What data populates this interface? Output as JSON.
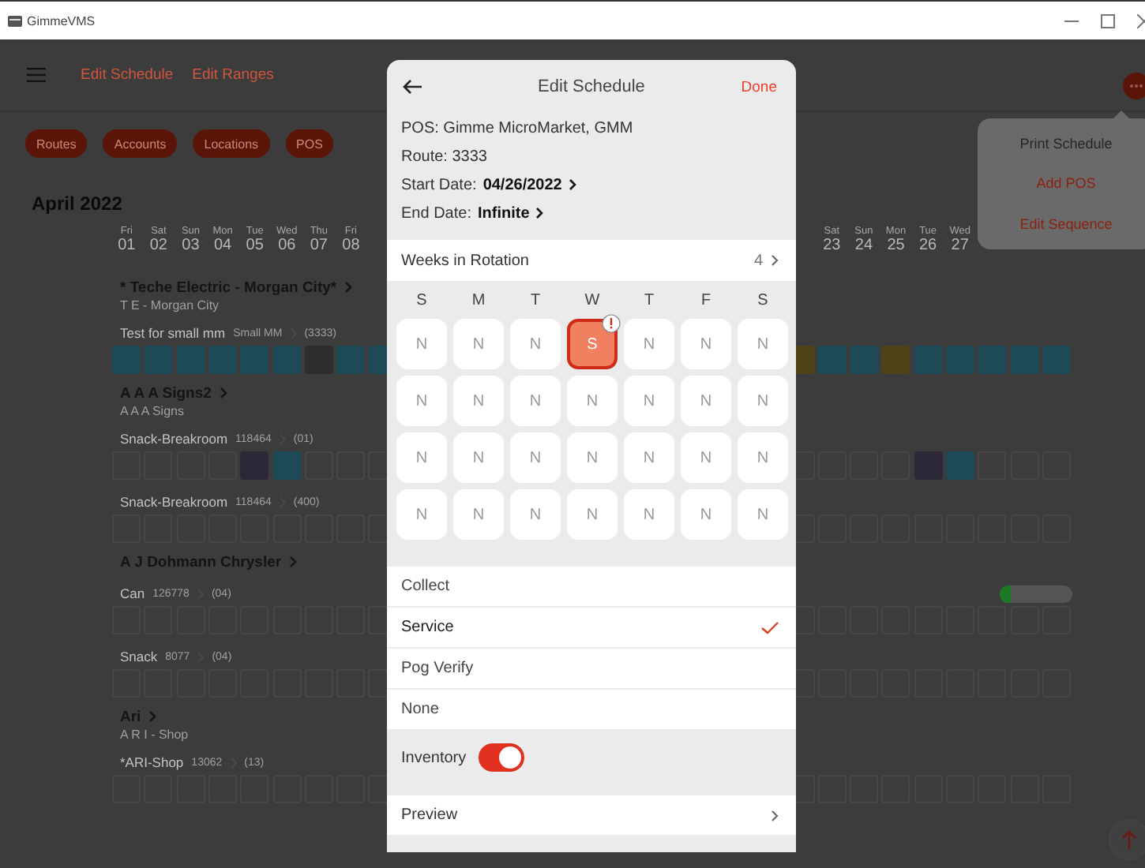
{
  "window": {
    "title": "GimmeVMS"
  },
  "toolbar": {
    "links": [
      "Edit Schedule",
      "Edit Ranges"
    ]
  },
  "filters": [
    "Routes",
    "Accounts",
    "Locations",
    "POS"
  ],
  "month": "April 2022",
  "days": {
    "start": [
      {
        "weekday": "Fri",
        "date": "01"
      },
      {
        "weekday": "Sat",
        "date": "02"
      },
      {
        "weekday": "Sun",
        "date": "03"
      },
      {
        "weekday": "Mon",
        "date": "04"
      },
      {
        "weekday": "Tue",
        "date": "05"
      },
      {
        "weekday": "Wed",
        "date": "06"
      },
      {
        "weekday": "Thu",
        "date": "07"
      },
      {
        "weekday": "Fri",
        "date": "08"
      }
    ],
    "end": [
      {
        "weekday": "Sat",
        "date": "23"
      },
      {
        "weekday": "Sun",
        "date": "24"
      },
      {
        "weekday": "Mon",
        "date": "25"
      },
      {
        "weekday": "Tue",
        "date": "26"
      },
      {
        "weekday": "Wed",
        "date": "27"
      }
    ]
  },
  "locations": [
    {
      "name": "* Teche Electric - Morgan City*",
      "subtitle": "T E - Morgan City",
      "pos": [
        {
          "name": "Test for small mm",
          "code": "Small MM",
          "route": "(3333)",
          "cells_start": [
            {
              "filled": true,
              "color": "#1e4a58"
            },
            {
              "filled": true,
              "color": "#1e4a58"
            },
            {
              "filled": true,
              "color": "#1e4a58"
            },
            {
              "filled": true,
              "color": "#1e4a58"
            },
            {
              "filled": true,
              "color": "#1e4a58"
            },
            {
              "filled": true,
              "color": "#1e4a58"
            },
            {
              "filled": true,
              "color": "#2e2e2e"
            },
            {
              "filled": true,
              "color": "#1e4a58"
            },
            {
              "filled": true,
              "color": "#1e4a58"
            }
          ],
          "cells_end": [
            {
              "filled": true,
              "color": "#4d4218"
            },
            {
              "filled": true,
              "color": "#1e4a58"
            },
            {
              "filled": true,
              "color": "#1e4a58"
            },
            {
              "filled": true,
              "color": "#4d4218"
            },
            {
              "filled": true,
              "color": "#1e4a58"
            },
            {
              "filled": true,
              "color": "#1e4a58"
            },
            {
              "filled": true,
              "color": "#1e4a58"
            },
            {
              "filled": true,
              "color": "#1e4a58"
            },
            {
              "filled": true,
              "color": "#1e4a58"
            }
          ]
        }
      ]
    },
    {
      "name": "A A A Signs2",
      "subtitle": "A A A Signs",
      "pos": [
        {
          "name": "Snack-Breakroom",
          "code": "118464",
          "route": "(01)",
          "cells_start": [
            {
              "filled": false
            },
            {
              "filled": false
            },
            {
              "filled": false
            },
            {
              "filled": false
            },
            {
              "filled": true,
              "color": "#2c2838"
            },
            {
              "filled": true,
              "color": "#1e4a58"
            },
            {
              "filled": false
            },
            {
              "filled": false
            },
            {
              "filled": false
            }
          ],
          "cells_end": [
            {
              "filled": false
            },
            {
              "filled": false
            },
            {
              "filled": false
            },
            {
              "filled": false
            },
            {
              "filled": true,
              "color": "#2c2838"
            },
            {
              "filled": true,
              "color": "#1e4a58"
            },
            {
              "filled": false
            },
            {
              "filled": false
            },
            {
              "filled": false
            }
          ]
        },
        {
          "name": "Snack-Breakroom",
          "code": "118464",
          "route": "(400)",
          "cells_start": [
            {
              "filled": false
            },
            {
              "filled": false
            },
            {
              "filled": false
            },
            {
              "filled": false
            },
            {
              "filled": false
            },
            {
              "filled": false
            },
            {
              "filled": false
            },
            {
              "filled": false
            },
            {
              "filled": false
            }
          ],
          "cells_end": [
            {
              "filled": false
            },
            {
              "filled": false
            },
            {
              "filled": false
            },
            {
              "filled": false
            },
            {
              "filled": false
            },
            {
              "filled": false
            },
            {
              "filled": false
            },
            {
              "filled": false
            },
            {
              "filled": false
            }
          ]
        }
      ]
    },
    {
      "name": "A J Dohmann Chrysler",
      "pos": [
        {
          "name": "Can",
          "code": "126778",
          "route": "(04)",
          "level": 0.15,
          "cells_start": [
            {
              "filled": false
            },
            {
              "filled": false
            },
            {
              "filled": false
            },
            {
              "filled": false
            },
            {
              "filled": false
            },
            {
              "filled": false
            },
            {
              "filled": false
            },
            {
              "filled": false
            },
            {
              "filled": false
            }
          ],
          "cells_end": [
            {
              "filled": false
            },
            {
              "filled": false
            },
            {
              "filled": false
            },
            {
              "filled": false
            },
            {
              "filled": false
            },
            {
              "filled": false
            },
            {
              "filled": false
            },
            {
              "filled": false
            },
            {
              "filled": false
            }
          ]
        },
        {
          "name": "Snack",
          "code": "8077",
          "route": "(04)",
          "cells_start": [
            {
              "filled": false
            },
            {
              "filled": false
            },
            {
              "filled": false
            },
            {
              "filled": false
            },
            {
              "filled": false
            },
            {
              "filled": false
            },
            {
              "filled": false
            },
            {
              "filled": false
            },
            {
              "filled": false
            }
          ],
          "cells_end": [
            {
              "filled": false
            },
            {
              "filled": false
            },
            {
              "filled": false
            },
            {
              "filled": false
            },
            {
              "filled": false
            },
            {
              "filled": false
            },
            {
              "filled": false
            },
            {
              "filled": false
            },
            {
              "filled": false
            }
          ]
        }
      ]
    },
    {
      "name": "Ari",
      "subtitle": "A R I - Shop",
      "pos": [
        {
          "name": "*ARI-Shop",
          "code": "13062",
          "route": "(13)",
          "cells_start": [
            {
              "filled": false
            },
            {
              "filled": false
            },
            {
              "filled": false
            },
            {
              "filled": false
            },
            {
              "filled": false
            },
            {
              "filled": false
            },
            {
              "filled": false
            },
            {
              "filled": false
            },
            {
              "filled": false
            }
          ],
          "cells_end": [
            {
              "filled": false
            },
            {
              "filled": false
            },
            {
              "filled": false
            },
            {
              "filled": false
            },
            {
              "filled": false
            },
            {
              "filled": false
            },
            {
              "filled": false
            },
            {
              "filled": false
            },
            {
              "filled": false
            }
          ]
        }
      ]
    }
  ],
  "menu": [
    {
      "label": "Print Schedule",
      "disabled": true
    },
    {
      "label": "Add POS",
      "disabled": false
    },
    {
      "label": "Edit Sequence",
      "disabled": false
    }
  ],
  "editor": {
    "title": "Edit Schedule",
    "done": "Done",
    "info": [
      {
        "label": "POS: Gimme MicroMarket, GMM"
      },
      {
        "label": "Route: 3333"
      },
      {
        "label": "Start Date:",
        "value": "04/26/2022"
      },
      {
        "label": "End Date:",
        "value": "Infinite"
      }
    ],
    "rotation": {
      "label": "Weeks in Rotation",
      "value": "4"
    },
    "weekdays": [
      "S",
      "M",
      "T",
      "W",
      "T",
      "F",
      "S"
    ],
    "weeks": [
      [
        {
          "letter": "N",
          "selected": false,
          "alert": false
        },
        {
          "letter": "N",
          "selected": false,
          "alert": false
        },
        {
          "letter": "N",
          "selected": false,
          "alert": false
        },
        {
          "letter": "S",
          "selected": true,
          "alert": true
        },
        {
          "letter": "N",
          "selected": false,
          "alert": false
        },
        {
          "letter": "N",
          "selected": false,
          "alert": false
        },
        {
          "letter": "N",
          "selected": false,
          "alert": false
        }
      ],
      [
        {
          "letter": "N",
          "selected": false,
          "alert": false
        },
        {
          "letter": "N",
          "selected": false,
          "alert": false
        },
        {
          "letter": "N",
          "selected": false,
          "alert": false
        },
        {
          "letter": "N",
          "selected": false,
          "alert": false
        },
        {
          "letter": "N",
          "selected": false,
          "alert": false
        },
        {
          "letter": "N",
          "selected": false,
          "alert": false
        },
        {
          "letter": "N",
          "selected": false,
          "alert": false
        }
      ],
      [
        {
          "letter": "N",
          "selected": false,
          "alert": false
        },
        {
          "letter": "N",
          "selected": false,
          "alert": false
        },
        {
          "letter": "N",
          "selected": false,
          "alert": false
        },
        {
          "letter": "N",
          "selected": false,
          "alert": false
        },
        {
          "letter": "N",
          "selected": false,
          "alert": false
        },
        {
          "letter": "N",
          "selected": false,
          "alert": false
        },
        {
          "letter": "N",
          "selected": false,
          "alert": false
        }
      ],
      [
        {
          "letter": "N",
          "selected": false,
          "alert": false
        },
        {
          "letter": "N",
          "selected": false,
          "alert": false
        },
        {
          "letter": "N",
          "selected": false,
          "alert": false
        },
        {
          "letter": "N",
          "selected": false,
          "alert": false
        },
        {
          "letter": "N",
          "selected": false,
          "alert": false
        },
        {
          "letter": "N",
          "selected": false,
          "alert": false
        },
        {
          "letter": "N",
          "selected": false,
          "alert": false
        }
      ]
    ],
    "actions": [
      {
        "label": "Collect",
        "selected": false
      },
      {
        "label": "Service",
        "selected": true
      },
      {
        "label": "Pog Verify",
        "selected": false
      },
      {
        "label": "None",
        "selected": false
      }
    ],
    "inventory": {
      "label": "Inventory",
      "on": true
    },
    "preview": "Preview"
  }
}
